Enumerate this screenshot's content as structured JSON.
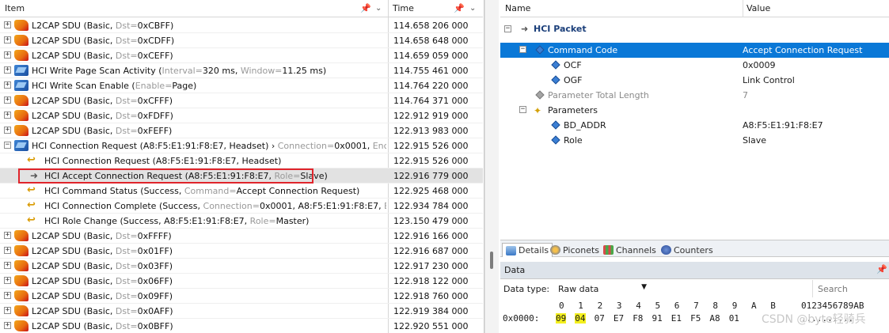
{
  "left": {
    "col_item": "Item",
    "col_time": "Time",
    "rows": [
      {
        "exp": "+",
        "icon": "l2",
        "text": "L2CAP SDU (Basic, ",
        "g": "Dst=",
        "rest": "0xCBFF)",
        "time": "114.658 206 000"
      },
      {
        "exp": "+",
        "icon": "l2",
        "text": "L2CAP SDU (Basic, ",
        "g": "Dst=",
        "rest": "0xCDFF)",
        "time": "114.658 648 000"
      },
      {
        "exp": "+",
        "icon": "l2",
        "text": "L2CAP SDU (Basic, ",
        "g": "Dst=",
        "rest": "0xCEFF)",
        "time": "114.659 059 000"
      },
      {
        "exp": "+",
        "icon": "hci",
        "text": "HCI Write Page Scan Activity (",
        "g": "Interval=",
        "rest": "320 ms, ",
        "g2": "Window=",
        "rest2": "11.25 ms)",
        "time": "114.755 461 000"
      },
      {
        "exp": "+",
        "icon": "hci",
        "text": "HCI Write Scan Enable (",
        "g": "Enable=",
        "rest": "Page)",
        "time": "114.764 220 000"
      },
      {
        "exp": "+",
        "icon": "l2",
        "text": "L2CAP SDU (Basic, ",
        "g": "Dst=",
        "rest": "0xCFFF)",
        "time": "114.764 371 000"
      },
      {
        "exp": "+",
        "icon": "l2",
        "text": "L2CAP SDU (Basic, ",
        "g": "Dst=",
        "rest": "0xFDFF)",
        "time": "122.912 919 000"
      },
      {
        "exp": "+",
        "icon": "l2",
        "text": "L2CAP SDU (Basic, ",
        "g": "Dst=",
        "rest": "0xFEFF)",
        "time": "122.913 983 000"
      },
      {
        "exp": "−",
        "icon": "hci",
        "text": "HCI Connection Request (A8:F5:E1:91:F8:E7, Headset) › ",
        "g": "Connection=",
        "rest": "0x0001, ",
        "g2": "Encryption=",
        "rest2": "[",
        "time": "122.915 526 000"
      },
      {
        "exp": "",
        "icon": "evt",
        "ind": true,
        "text": "HCI Connection Request (A8:F5:E1:91:F8:E7, Headset)",
        "g": "",
        "rest": "",
        "time": "122.915 526 000"
      },
      {
        "exp": "",
        "icon": "cmd",
        "ind": true,
        "sel": true,
        "text": "HCI Accept Connection Request (A8:F5:E1:91:F8:E7, ",
        "g": "Role=",
        "rest": "Slave)",
        "time": "122.916 779 000"
      },
      {
        "exp": "",
        "icon": "evt",
        "ind": true,
        "text": "HCI Command Status (Success, ",
        "g": "Command=",
        "rest": "Accept Connection Request)",
        "time": "122.925 468 000"
      },
      {
        "exp": "",
        "icon": "evt",
        "ind": true,
        "text": "HCI Connection Complete (Success, ",
        "g": "Connection=",
        "rest": "0x0001, A8:F5:E1:91:F8:E7, ",
        "g2": "Encrypt...",
        "rest2": "",
        "time": "122.934 784 000"
      },
      {
        "exp": "",
        "icon": "evt",
        "ind": true,
        "text": "HCI Role Change (Success, A8:F5:E1:91:F8:E7, ",
        "g": "Role=",
        "rest": "Master)",
        "time": "123.150 479 000"
      },
      {
        "exp": "+",
        "icon": "l2",
        "text": "L2CAP SDU (Basic, ",
        "g": "Dst=",
        "rest": "0xFFFF)",
        "time": "122.916 166 000"
      },
      {
        "exp": "+",
        "icon": "l2",
        "text": "L2CAP SDU (Basic, ",
        "g": "Dst=",
        "rest": "0x01FF)",
        "time": "122.916 687 000"
      },
      {
        "exp": "+",
        "icon": "l2",
        "text": "L2CAP SDU (Basic, ",
        "g": "Dst=",
        "rest": "0x03FF)",
        "time": "122.917 230 000"
      },
      {
        "exp": "+",
        "icon": "l2",
        "text": "L2CAP SDU (Basic, ",
        "g": "Dst=",
        "rest": "0x06FF)",
        "time": "122.918 122 000"
      },
      {
        "exp": "+",
        "icon": "l2",
        "text": "L2CAP SDU (Basic, ",
        "g": "Dst=",
        "rest": "0x09FF)",
        "time": "122.918 760 000"
      },
      {
        "exp": "+",
        "icon": "l2",
        "text": "L2CAP SDU (Basic, ",
        "g": "Dst=",
        "rest": "0x0AFF)",
        "time": "122.919 384 000"
      },
      {
        "exp": "+",
        "icon": "l2",
        "text": "L2CAP SDU (Basic, ",
        "g": "Dst=",
        "rest": "0x0BFF)",
        "time": "122.920 551 000"
      }
    ]
  },
  "right": {
    "col_name": "Name",
    "col_value": "Value",
    "packet_title": "HCI Packet",
    "props": [
      {
        "exp": "−",
        "icon": "diamond",
        "name": "Command Code",
        "value": "Accept Connection Request",
        "sel": true
      },
      {
        "exp": "",
        "icon": "diamond",
        "name": "OCF",
        "value": "0x0009",
        "ind": true
      },
      {
        "exp": "",
        "icon": "diamond",
        "name": "OGF",
        "value": "Link Control",
        "ind": true
      },
      {
        "exp": "",
        "icon": "diamond-gray",
        "name": "Parameter Total Length",
        "value": "7",
        "gray": true
      },
      {
        "exp": "−",
        "icon": "params",
        "name": "Parameters",
        "value": ""
      },
      {
        "exp": "",
        "icon": "diamond",
        "name": "BD_ADDR",
        "value": "A8:F5:E1:91:F8:E7",
        "ind": true
      },
      {
        "exp": "",
        "icon": "diamond",
        "name": "Role",
        "value": "Slave",
        "ind": true
      }
    ],
    "tabs": [
      "Details",
      "Piconets",
      "Channels",
      "Counters"
    ],
    "data_title": "Data",
    "data_type_label": "Data type:",
    "data_type_value": "Raw data",
    "search_placeholder": "Search",
    "hex_header": [
      "0",
      "1",
      "2",
      "3",
      "4",
      "5",
      "6",
      "7",
      "8",
      "9",
      "A",
      "B"
    ],
    "ascii_header": "0123456789AB",
    "hex_offset": "0x0000:",
    "hex_bytes": [
      "09",
      "04",
      "07",
      "E7",
      "F8",
      "91",
      "E1",
      "F5",
      "A8",
      "01"
    ],
    "ascii_row": "..........",
    "watermark": "CSDN @byte轻骑兵"
  }
}
